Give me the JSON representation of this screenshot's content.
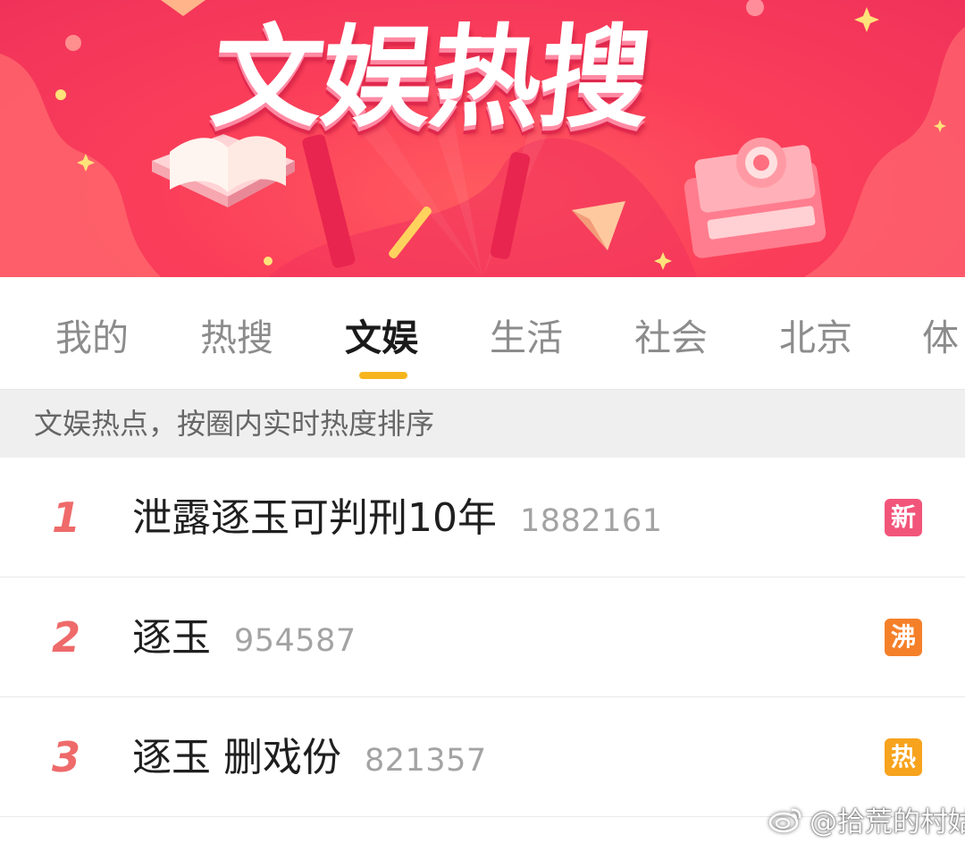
{
  "banner": {
    "title": "文娱热搜"
  },
  "tabs": [
    {
      "label": "我的",
      "active": false
    },
    {
      "label": "热搜",
      "active": false
    },
    {
      "label": "文娱",
      "active": true
    },
    {
      "label": "生活",
      "active": false
    },
    {
      "label": "社会",
      "active": false
    },
    {
      "label": "北京",
      "active": false
    },
    {
      "label": "体",
      "active": false
    }
  ],
  "subtitle": "文娱热点，按圈内实时热度排序",
  "list": [
    {
      "rank": "1",
      "title": "泄露逐玉可判刑10年",
      "count": "1882161",
      "badge": "新",
      "badge_color": "#f2557a"
    },
    {
      "rank": "2",
      "title": "逐玉",
      "count": "954587",
      "badge": "沸",
      "badge_color": "#f5802a"
    },
    {
      "rank": "3",
      "title": "逐玉 删戏份",
      "count": "821357",
      "badge": "热",
      "badge_color": "#f7a31d"
    }
  ],
  "watermark": {
    "text": "@拾荒的村姑",
    "icon": "weibo-logo-icon"
  },
  "colors": {
    "banner_red": "#fb3f5a",
    "tab_indicator": "#f7b51d",
    "rank_red": "#ef6a6a"
  }
}
